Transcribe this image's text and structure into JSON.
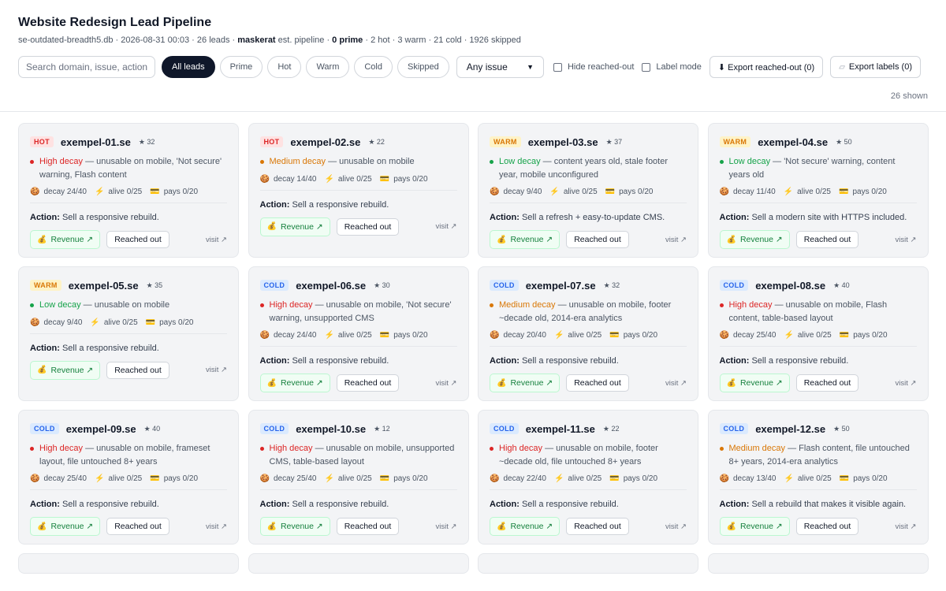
{
  "header": {
    "title": "Website Redesign Lead Pipeline",
    "sub_db": "se-outdated-breadth5.db",
    "sub_date": "2026-08-31 00:03",
    "sub_leads": "26 leads",
    "sub_brand": "maskerat",
    "sub_est": "est. pipeline",
    "sub_prime": "0 prime",
    "sub_counts": "2 hot · 3 warm · 21 cold · 1926 skipped"
  },
  "toolbar": {
    "search_placeholder": "Search domain, issue, action",
    "filters": [
      "All leads",
      "Prime",
      "Hot",
      "Warm",
      "Cold",
      "Skipped"
    ],
    "issue_select": "Any issue",
    "hide_reached": "Hide reached-out",
    "label_mode": "Label mode",
    "export_reached": "⬇ Export reached-out (0)",
    "export_labels": "Export labels (0)",
    "shown": "26 shown"
  },
  "card_labels": {
    "action_prefix": "Action:",
    "revenue": "Revenue ↗",
    "reached": "Reached out",
    "visit": "visit ↗",
    "decay_prefix": "decay",
    "alive_prefix": "alive",
    "pays_prefix": "pays"
  },
  "icons": {
    "decay": "🍪",
    "alive": "⚡",
    "pays": "💳",
    "revenue": "💰",
    "star": "★"
  },
  "colors": {
    "hot": "#dc2626",
    "warm": "#d97706",
    "cold": "#2563eb",
    "low": "#16a34a"
  },
  "cards": [
    {
      "tier": "HOT",
      "domain": "exempel-01.se",
      "stars": "★ 32",
      "level": "High decay",
      "issue": " — unusable on mobile, 'Not secure' warning, Flash content",
      "decay": "24/40",
      "alive": "0/25",
      "pays": "0/20",
      "action": "Sell a responsive rebuild."
    },
    {
      "tier": "HOT",
      "domain": "exempel-02.se",
      "stars": "★ 22",
      "level": "Medium decay",
      "issue": " — unusable on mobile",
      "decay": "14/40",
      "alive": "0/25",
      "pays": "0/20",
      "action": "Sell a responsive rebuild."
    },
    {
      "tier": "WARM",
      "domain": "exempel-03.se",
      "stars": "★ 37",
      "level": "Low decay",
      "issue": " — content years old, stale footer year, mobile unconfigured",
      "decay": "9/40",
      "alive": "0/25",
      "pays": "0/20",
      "action": "Sell a refresh + easy-to-update CMS."
    },
    {
      "tier": "WARM",
      "domain": "exempel-04.se",
      "stars": "★ 50",
      "level": "Low decay",
      "issue": " — 'Not secure' warning, content years old",
      "decay": "11/40",
      "alive": "0/25",
      "pays": "0/20",
      "action": "Sell a modern site with HTTPS included."
    },
    {
      "tier": "WARM",
      "domain": "exempel-05.se",
      "stars": "★ 35",
      "level": "Low decay",
      "issue": " — unusable on mobile",
      "decay": "9/40",
      "alive": "0/25",
      "pays": "0/20",
      "action": "Sell a responsive rebuild."
    },
    {
      "tier": "COLD",
      "domain": "exempel-06.se",
      "stars": "★ 30",
      "level": "High decay",
      "issue": " — unusable on mobile, 'Not secure' warning, unsupported CMS",
      "decay": "24/40",
      "alive": "0/25",
      "pays": "0/20",
      "action": "Sell a responsive rebuild."
    },
    {
      "tier": "COLD",
      "domain": "exempel-07.se",
      "stars": "★ 32",
      "level": "Medium decay",
      "issue": " — unusable on mobile, footer ~decade old, 2014-era analytics",
      "decay": "20/40",
      "alive": "0/25",
      "pays": "0/20",
      "action": "Sell a responsive rebuild."
    },
    {
      "tier": "COLD",
      "domain": "exempel-08.se",
      "stars": "★ 40",
      "level": "High decay",
      "issue": " — unusable on mobile, Flash content, table-based layout",
      "decay": "25/40",
      "alive": "0/25",
      "pays": "0/20",
      "action": "Sell a responsive rebuild."
    },
    {
      "tier": "COLD",
      "domain": "exempel-09.se",
      "stars": "★ 40",
      "level": "High decay",
      "issue": " — unusable on mobile, frameset layout, file untouched 8+ years",
      "decay": "25/40",
      "alive": "0/25",
      "pays": "0/20",
      "action": "Sell a responsive rebuild."
    },
    {
      "tier": "COLD",
      "domain": "exempel-10.se",
      "stars": "★ 12",
      "level": "High decay",
      "issue": " — unusable on mobile, unsupported CMS, table-based layout",
      "decay": "25/40",
      "alive": "0/25",
      "pays": "0/20",
      "action": "Sell a responsive rebuild."
    },
    {
      "tier": "COLD",
      "domain": "exempel-11.se",
      "stars": "★ 22",
      "level": "High decay",
      "issue": " — unusable on mobile, footer ~decade old, file untouched 8+ years",
      "decay": "22/40",
      "alive": "0/25",
      "pays": "0/20",
      "action": "Sell a responsive rebuild."
    },
    {
      "tier": "COLD",
      "domain": "exempel-12.se",
      "stars": "★ 50",
      "level": "Medium decay",
      "issue": " — Flash content, file untouched 8+ years, 2014-era analytics",
      "decay": "13/40",
      "alive": "0/25",
      "pays": "0/20",
      "action": "Sell a rebuild that makes it visible again."
    }
  ]
}
